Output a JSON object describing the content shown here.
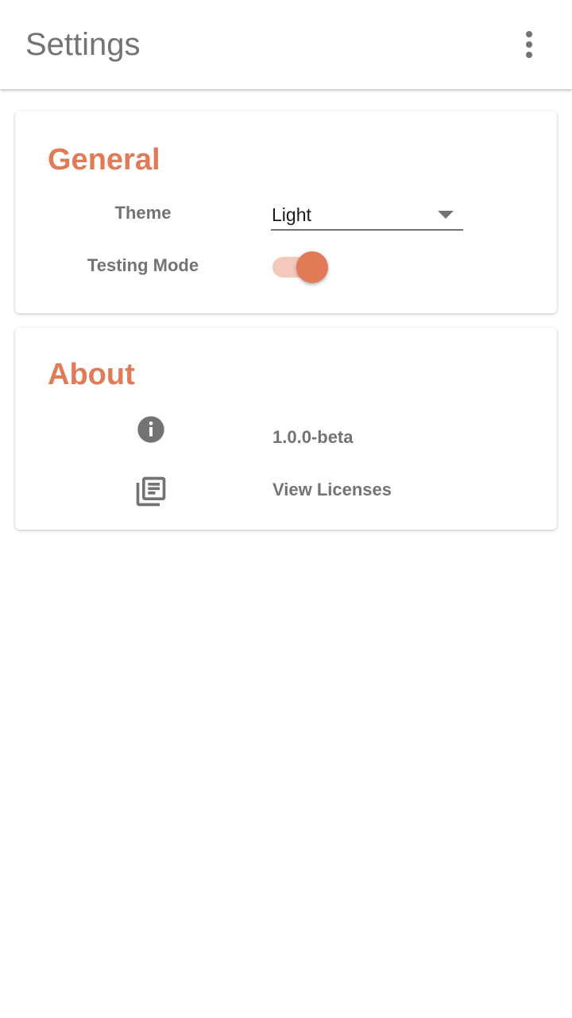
{
  "appbar": {
    "title": "Settings",
    "overflow_icon": "more-vert-icon"
  },
  "general": {
    "title": "General",
    "theme": {
      "label": "Theme",
      "value": "Light"
    },
    "testing_mode": {
      "label": "Testing Mode",
      "enabled": true
    }
  },
  "about": {
    "title": "About",
    "version": {
      "icon": "info-icon",
      "text": "1.0.0-beta"
    },
    "licenses": {
      "icon": "library-books-icon",
      "text": "View Licenses"
    }
  },
  "colors": {
    "accent": "#e07a57",
    "accent_light": "#f2c9ba",
    "text_muted": "#737373"
  }
}
